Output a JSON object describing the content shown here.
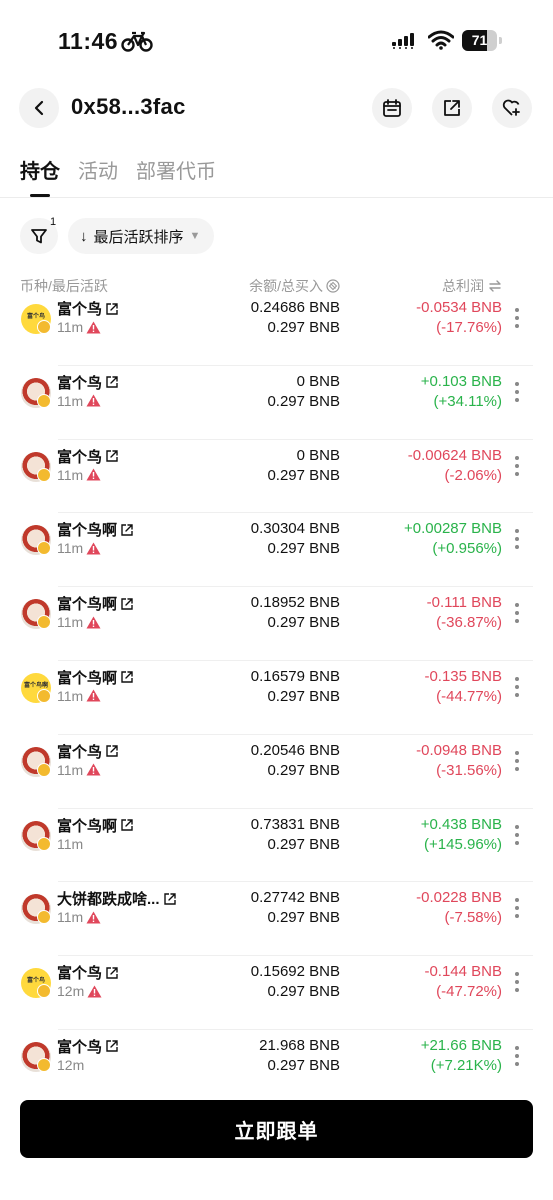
{
  "status_bar": {
    "time": "11:46",
    "battery": "71",
    "battery_level": 0.71
  },
  "header": {
    "title": "0x58...3fac"
  },
  "tabs": [
    {
      "label": "持仓",
      "active": true
    },
    {
      "label": "活动",
      "active": false
    },
    {
      "label": "部署代币",
      "active": false
    }
  ],
  "filter": {
    "count": "1",
    "sort_label": "最后活跃排序"
  },
  "columns": {
    "token": "币种/最后活跃",
    "balance": "余额/总买入",
    "pnl": "总利润"
  },
  "rows": [
    {
      "name": "富个鸟",
      "time": "11m",
      "warn": true,
      "avatar": "yellow",
      "avatar_text": "富个鸟",
      "bal": "0.24686 BNB",
      "buy": "0.297 BNB",
      "pnl": "-0.0534 BNB",
      "pct": "(-17.76%)",
      "sign": "neg"
    },
    {
      "name": "富个鸟",
      "time": "11m",
      "warn": true,
      "avatar": "photo",
      "avatar_text": "",
      "bal": "0 BNB",
      "buy": "0.297 BNB",
      "pnl": "+0.103 BNB",
      "pct": "(+34.11%)",
      "sign": "pos"
    },
    {
      "name": "富个鸟",
      "time": "11m",
      "warn": true,
      "avatar": "photo",
      "avatar_text": "",
      "bal": "0 BNB",
      "buy": "0.297 BNB",
      "pnl": "-0.00624 BNB",
      "pct": "(-2.06%)",
      "sign": "neg"
    },
    {
      "name": "富个鸟啊",
      "time": "11m",
      "warn": true,
      "avatar": "photo",
      "avatar_text": "",
      "bal": "0.30304 BNB",
      "buy": "0.297 BNB",
      "pnl": "+0.00287 BNB",
      "pct": "(+0.956%)",
      "sign": "pos"
    },
    {
      "name": "富个鸟啊",
      "time": "11m",
      "warn": true,
      "avatar": "photo",
      "avatar_text": "",
      "bal": "0.18952 BNB",
      "buy": "0.297 BNB",
      "pnl": "-0.111 BNB",
      "pct": "(-36.87%)",
      "sign": "neg"
    },
    {
      "name": "富个鸟啊",
      "time": "11m",
      "warn": true,
      "avatar": "yellow",
      "avatar_text": "富个鸟啊",
      "bal": "0.16579 BNB",
      "buy": "0.297 BNB",
      "pnl": "-0.135 BNB",
      "pct": "(-44.77%)",
      "sign": "neg"
    },
    {
      "name": "富个鸟",
      "time": "11m",
      "warn": true,
      "avatar": "photo",
      "avatar_text": "",
      "bal": "0.20546 BNB",
      "buy": "0.297 BNB",
      "pnl": "-0.0948 BNB",
      "pct": "(-31.56%)",
      "sign": "neg"
    },
    {
      "name": "富个鸟啊",
      "time": "11m",
      "warn": false,
      "avatar": "photo",
      "avatar_text": "",
      "bal": "0.73831 BNB",
      "buy": "0.297 BNB",
      "pnl": "+0.438 BNB",
      "pct": "(+145.96%)",
      "sign": "pos"
    },
    {
      "name": "大饼都跌成啥...",
      "time": "11m",
      "warn": true,
      "avatar": "photo",
      "avatar_text": "",
      "bal": "0.27742 BNB",
      "buy": "0.297 BNB",
      "pnl": "-0.0228 BNB",
      "pct": "(-7.58%)",
      "sign": "neg"
    },
    {
      "name": "富个鸟",
      "time": "12m",
      "warn": true,
      "avatar": "yellow",
      "avatar_text": "富个鸟",
      "bal": "0.15692 BNB",
      "buy": "0.297 BNB",
      "pnl": "-0.144 BNB",
      "pct": "(-47.72%)",
      "sign": "neg"
    },
    {
      "name": "富个鸟",
      "time": "12m",
      "warn": false,
      "avatar": "photo",
      "avatar_text": "",
      "bal": "21.968 BNB",
      "buy": "0.297 BNB",
      "pnl": "+21.66 BNB",
      "pct": "(+7.21K%)",
      "sign": "pos"
    }
  ],
  "footer": {
    "button": "立即跟单"
  },
  "colors": {
    "negative": "#e0475b",
    "positive": "#2ab34b",
    "chain_badge": "#f3ba2f"
  }
}
